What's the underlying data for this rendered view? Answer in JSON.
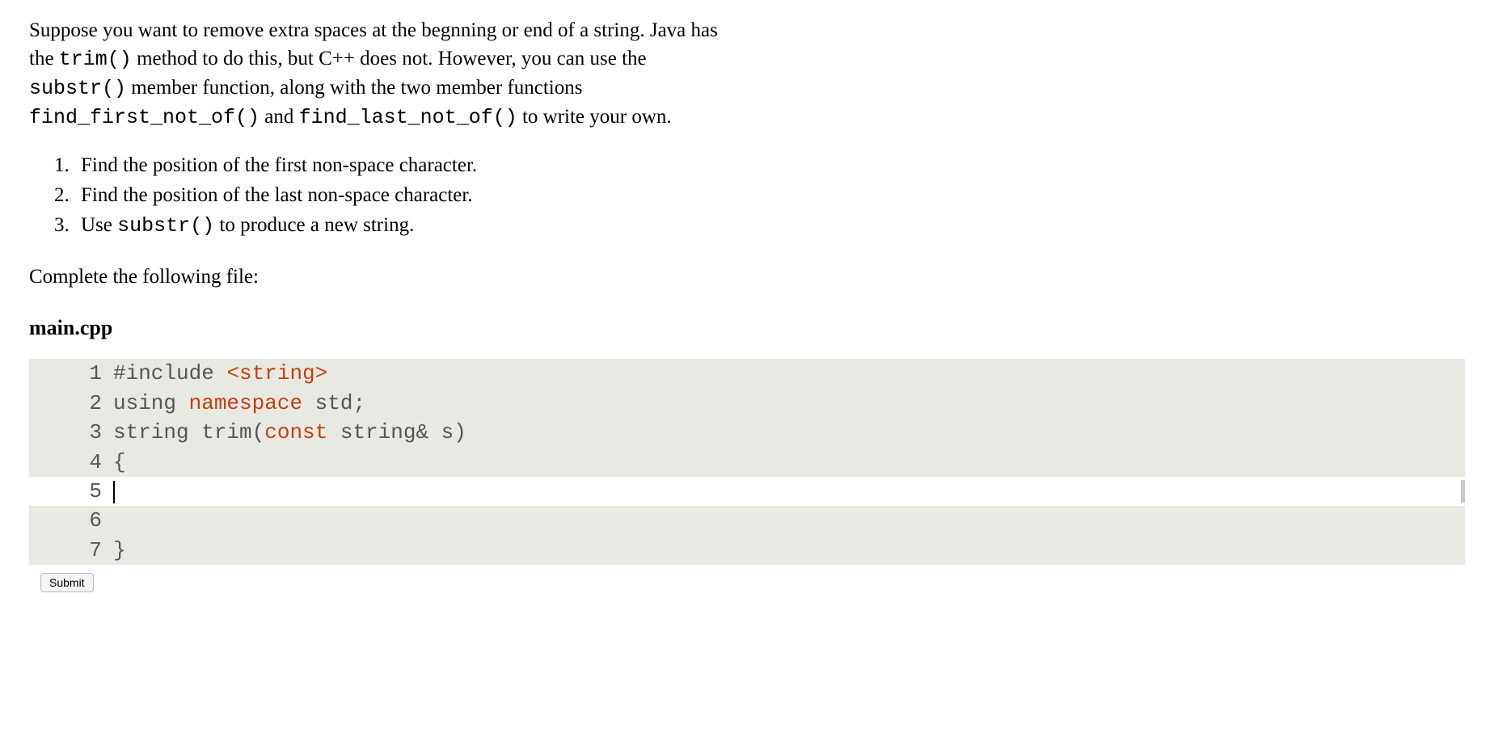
{
  "intro": {
    "part1": "Suppose you want to remove extra spaces at the begnning or end of a string. Java has the ",
    "code1": "trim()",
    "part2": " method to do this, but C++ does not. However, you can use the ",
    "code2": "substr()",
    "part3": " member function, along with the two member functions ",
    "code3": "find_first_not_of()",
    "part4": " and ",
    "code4": "find_last_not_of()",
    "part5": " to write your own."
  },
  "steps": {
    "item1": "Find the position of the first non-space character.",
    "item2": "Find the position of the last non-space character.",
    "item3_pre": "Use ",
    "item3_code": "substr()",
    "item3_post": " to produce a new string."
  },
  "complete_prompt": "Complete the following file:",
  "filename": "main.cpp",
  "code": {
    "lines": [
      {
        "num": "1",
        "editable": false
      },
      {
        "num": "2",
        "editable": false
      },
      {
        "num": "3",
        "editable": false
      },
      {
        "num": "4",
        "editable": false
      },
      {
        "num": "5",
        "editable": true
      },
      {
        "num": "6",
        "editable": false
      },
      {
        "num": "7",
        "editable": false
      }
    ],
    "line1": {
      "pre": "#include ",
      "header": "<string>"
    },
    "line2": {
      "pre": "using ",
      "kw": "namespace",
      "post": " std;"
    },
    "line3": {
      "pre": "string trim(",
      "kw": "const",
      "post": " string& s)"
    },
    "line4": "{",
    "line5": "",
    "line6": "",
    "line7": "}"
  },
  "submit_label": "Submit"
}
